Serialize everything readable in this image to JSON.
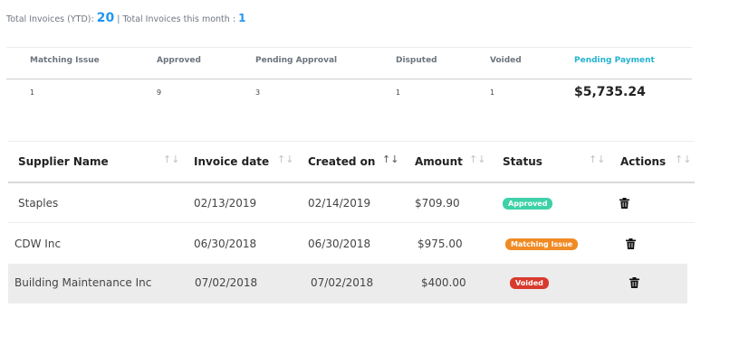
{
  "summary": {
    "ytd_label": "Total Invoices (YTD):",
    "ytd_value": "20",
    "separator": "|",
    "month_label": "Total Invoices this month :",
    "month_value": "1"
  },
  "stats": {
    "headers": [
      "Matching Issue",
      "Approved",
      "Pending Approval",
      "Disputed",
      "Voided",
      "Pending Payment"
    ],
    "values": [
      "1",
      "9",
      "3",
      "1",
      "1",
      "$5,735.24"
    ]
  },
  "invoices": {
    "columns": [
      "Supplier Name",
      "Invoice date",
      "Created on",
      "Amount",
      "Status",
      "Actions"
    ],
    "sort_icons": [
      "↑↓",
      "↑↓",
      "↑↓",
      "↑↓",
      "↑↓",
      "↑↓"
    ],
    "rows": [
      {
        "supplier": "Staples",
        "invoice_date": "02/13/2019",
        "created_on": "02/14/2019",
        "amount": "$709.90",
        "status": "Approved"
      },
      {
        "supplier": "CDW Inc",
        "invoice_date": "06/30/2018",
        "created_on": "06/30/2018",
        "amount": "$975.00",
        "status": "Matching Issue"
      },
      {
        "supplier": "Building Maintenance Inc",
        "invoice_date": "07/02/2018",
        "created_on": "07/02/2018",
        "amount": "$400.00",
        "status": "Voided"
      }
    ]
  },
  "colors": {
    "accent": "#2196f3",
    "pending_payment": "#26b3cf",
    "approved": "#3ed1a8",
    "matching_issue": "#f08a24",
    "voided": "#d93a2e",
    "row_highlight": "#ececec"
  },
  "icons": {
    "delete": "trash-icon",
    "sort": "sort-arrows-icon"
  }
}
